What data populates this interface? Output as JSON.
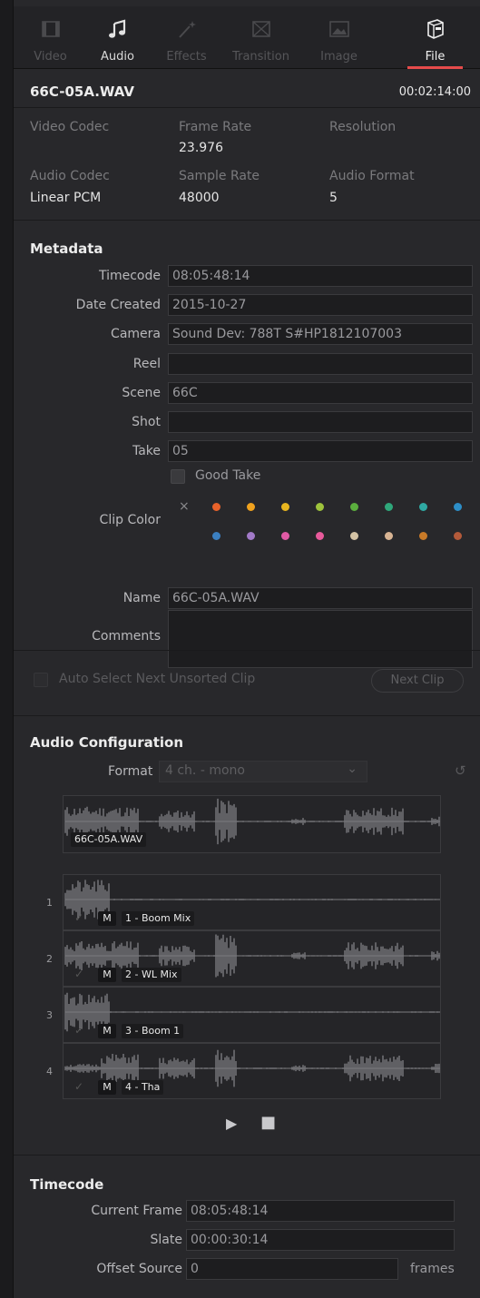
{
  "tabs": [
    {
      "label": "Video",
      "icon": "film-icon",
      "state": "disabled"
    },
    {
      "label": "Audio",
      "icon": "music-note-icon",
      "state": "enabled"
    },
    {
      "label": "Effects",
      "icon": "magic-wand-icon",
      "state": "disabled"
    },
    {
      "label": "Transition",
      "icon": "transition-icon",
      "state": "disabled"
    },
    {
      "label": "Image",
      "icon": "image-icon",
      "state": "disabled"
    },
    {
      "label": "File",
      "icon": "file-cabinet-icon",
      "state": "active"
    }
  ],
  "clip": {
    "name": "66C-05A.WAV",
    "duration": "00:02:14:00"
  },
  "info": {
    "video_codec_label": "Video Codec",
    "video_codec_value": "",
    "frame_rate_label": "Frame Rate",
    "frame_rate_value": "23.976",
    "resolution_label": "Resolution",
    "resolution_value": "",
    "audio_codec_label": "Audio Codec",
    "audio_codec_value": "Linear PCM",
    "sample_rate_label": "Sample Rate",
    "sample_rate_value": "48000",
    "audio_format_label": "Audio Format",
    "audio_format_value": "5"
  },
  "metadata": {
    "title": "Metadata",
    "timecode_label": "Timecode",
    "timecode_value": "08:05:48:14",
    "date_label": "Date Created",
    "date_value": "2015-10-27",
    "camera_label": "Camera",
    "camera_value": "Sound Dev: 788T S#HP1812107003",
    "reel_label": "Reel",
    "reel_value": "",
    "scene_label": "Scene",
    "scene_value": "66C",
    "shot_label": "Shot",
    "shot_value": "",
    "take_label": "Take",
    "take_value": "05",
    "good_take_label": "Good Take",
    "clip_color_label": "Clip Color",
    "clip_color_clear": "×",
    "clip_colors": [
      "#e8622a",
      "#f0a21e",
      "#e8b51f",
      "#9ec33c",
      "#5bae3e",
      "#2fa77a",
      "#2fa9a3",
      "#2d8ec7",
      "#3b7fc0",
      "#a27ac8",
      "#e05aa5",
      "#e85a9b",
      "#d4c3a5",
      "#d8b493",
      "#c87a28",
      "#b35a3a"
    ],
    "name_label": "Name",
    "name_value": "66C-05A.WAV",
    "comments_label": "Comments",
    "comments_value": "",
    "auto_select_label": "Auto Select Next Unsorted Clip",
    "next_clip_label": "Next Clip"
  },
  "audio_config": {
    "title": "Audio Configuration",
    "format_label": "Format",
    "format_value": "4 ch. - mono",
    "format_caret": "⌄",
    "reset_icon": "↺",
    "overview_label": "66C-05A.WAV",
    "channels": [
      {
        "num": "1",
        "check": "✓",
        "m": "M",
        "label": "1 - Boom Mix"
      },
      {
        "num": "2",
        "check": "✓",
        "m": "M",
        "label": "2 - WL Mix"
      },
      {
        "num": "3",
        "check": "✓",
        "m": "M",
        "label": "3 - Boom 1"
      },
      {
        "num": "4",
        "check": "✓",
        "m": "M",
        "label": "4 - Tha"
      }
    ],
    "play_glyph": "▶",
    "stop_glyph": "■"
  },
  "timecode": {
    "title": "Timecode",
    "current_frame_label": "Current Frame",
    "current_frame_value": "08:05:48:14",
    "slate_label": "Slate",
    "slate_value": "00:00:30:14",
    "offset_label": "Offset Source",
    "offset_value": "0",
    "offset_unit": "frames"
  },
  "colors": {
    "accent": "#e64b4b",
    "panel": "#28282b",
    "field": "#1d1d1f"
  }
}
